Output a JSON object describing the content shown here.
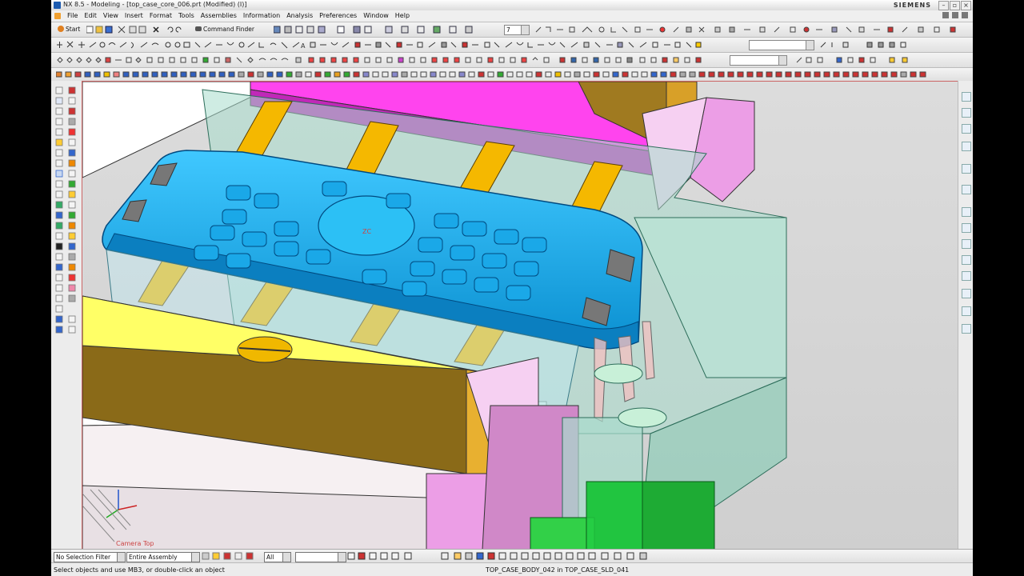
{
  "window": {
    "title": "NX 8.5 - Modeling - [top_case_core_006.prt (Modified)   (I)]",
    "brand": "SIEMENS",
    "controls": [
      "minimize",
      "restore",
      "close"
    ]
  },
  "menubar": {
    "items": [
      "File",
      "Edit",
      "View",
      "Insert",
      "Format",
      "Tools",
      "Assemblies",
      "Information",
      "Analysis",
      "Preferences",
      "Window",
      "Help"
    ]
  },
  "toolbar": {
    "start_label": "Start",
    "command_finder_label": "Command Finder",
    "layer_value": "7"
  },
  "viewport": {
    "wcs_label": "ZC",
    "camera_label": "Camera Top"
  },
  "selection_bar": {
    "filter": "No Selection Filter",
    "scope": "Entire Assembly",
    "type": "All",
    "snap": ""
  },
  "status": {
    "prompt": "Select objects and use MB3, or double-click an object",
    "selection": "TOP_CASE_BODY_042 in TOP_CASE_SLD_041"
  },
  "colors": {
    "part_blue": "#1fb4ee",
    "slider_yellow": "#ffff66",
    "slider_side": "#8a6a18",
    "pin_orange": "#f5b800",
    "bar_magenta": "#ff44ee",
    "plate_pink": "#f3c8f0",
    "transparent_green": "#a8dccc",
    "base_green": "#22cc44"
  }
}
